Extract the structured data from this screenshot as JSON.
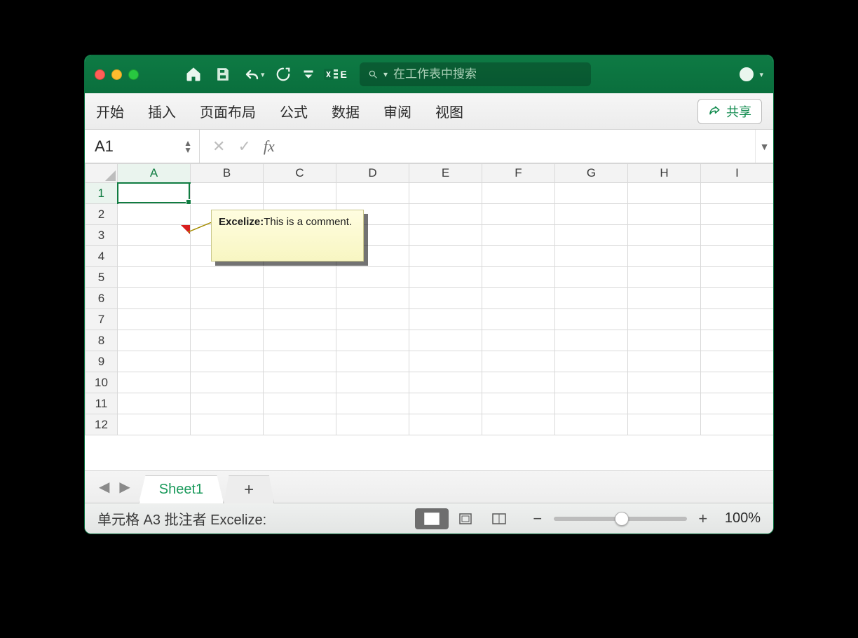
{
  "titlebar": {
    "search_placeholder": "在工作表中搜索"
  },
  "app_badge": "E",
  "ribbon": {
    "tabs": [
      "开始",
      "插入",
      "页面布局",
      "公式",
      "数据",
      "审阅",
      "视图"
    ],
    "share_label": "共享"
  },
  "formula_bar": {
    "name_box": "A1",
    "fx_label": "fx",
    "value": ""
  },
  "grid": {
    "columns": [
      "A",
      "B",
      "C",
      "D",
      "E",
      "F",
      "G",
      "H",
      "I"
    ],
    "rows": [
      "1",
      "2",
      "3",
      "4",
      "5",
      "6",
      "7",
      "8",
      "9",
      "10",
      "11",
      "12"
    ],
    "active_cell": "A1",
    "comment_cell": "A3"
  },
  "comment": {
    "author": "Excelize:",
    "text": "This is a comment."
  },
  "sheet_tabs": {
    "active": "Sheet1"
  },
  "status": {
    "text": "单元格 A3 批注者 Excelize:",
    "zoom": "100%"
  }
}
